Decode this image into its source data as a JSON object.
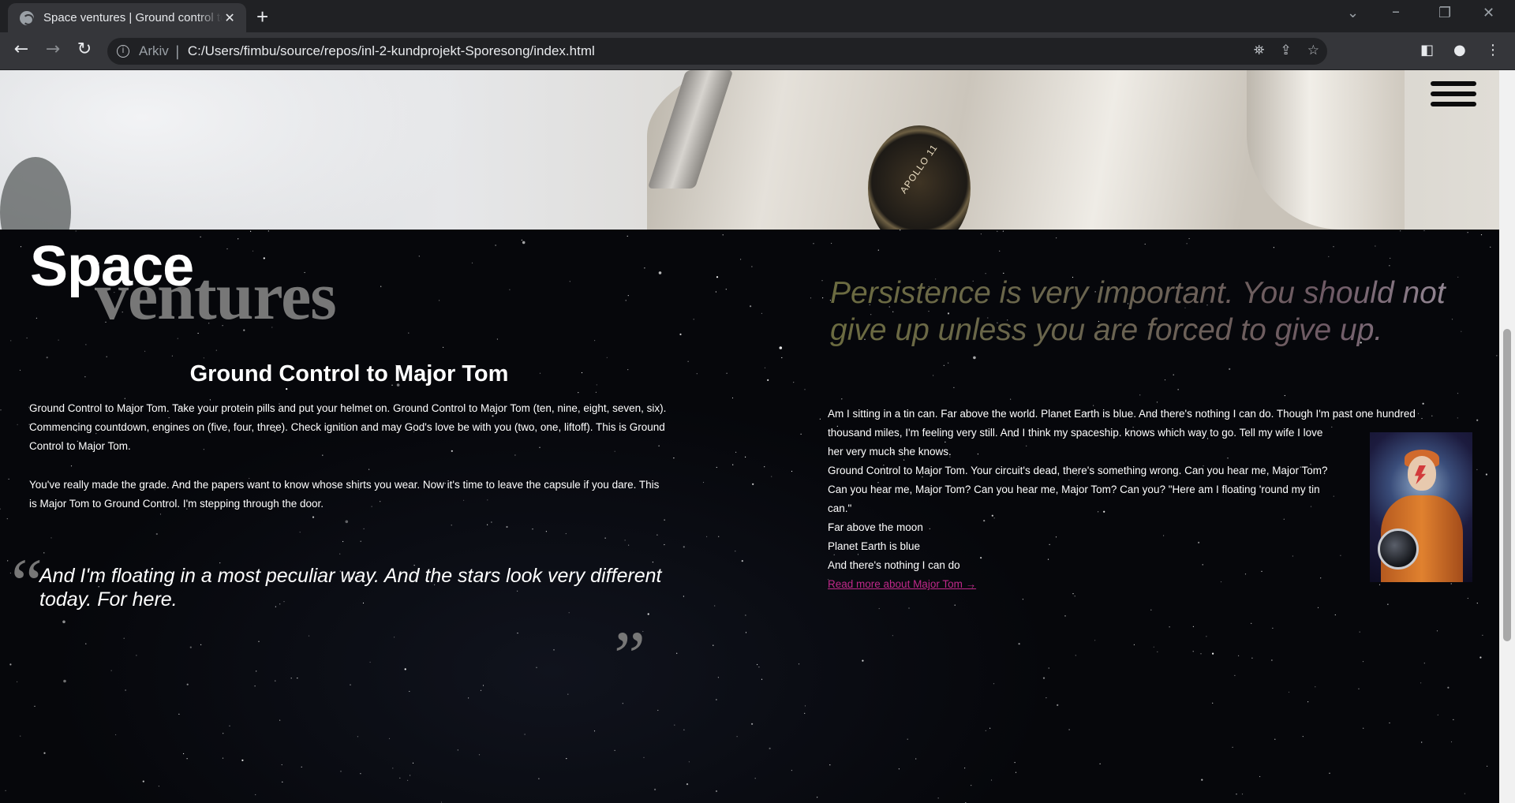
{
  "browser": {
    "tab_title": "Space ventures | Ground control to Major Tom",
    "tab_close": "✕",
    "new_tab": "+",
    "scheme_label": "Arkiv",
    "url": "C:/Users/fimbu/source/repos/inl-2-kundprojekt-Sporesong/index.html"
  },
  "hero": {
    "patch_text": "APOLLO 11"
  },
  "brand": {
    "word1": "Space",
    "word2": "ventures"
  },
  "motto": "Persistence is very important. You should not give up unless you are forced to give up.",
  "left": {
    "title": "Ground Control to Major Tom",
    "p1": "Ground Control to Major Tom. Take your protein pills and put your helmet on. Ground Control to Major Tom (ten, nine, eight, seven, six). Commencing countdown, engines on (five, four, three). Check ignition and may God's love be with you (two, one, liftoff). This is Ground Control to Major Tom.",
    "p2": "You've really made the grade. And the papers want to know whose shirts you wear. Now it's time to leave the capsule if you dare. This is Major Tom to Ground Control. I'm stepping through the door.",
    "quote_open": "“",
    "quote": "And I'm floating in a most peculiar way. And the stars look very different today. For here.",
    "quote_close": "”"
  },
  "right": {
    "line1": "Am I sitting in a tin can. Far above the world. Planet Earth is blue. And there's nothing I can do. Though I'm past one hundred",
    "line2": "thousand miles, I'm feeling very still. And I think my spaceship. knows which way to go. Tell my wife I love",
    "line3": "her very much she knows.",
    "line4": "Ground Control to Major Tom. Your circuit's dead, there's something wrong. Can you hear me, Major Tom?",
    "line5": "Can you hear me, Major Tom? Can you hear me, Major Tom? Can you? \"Here am I floating 'round my tin",
    "line6": "can.\"",
    "line7": "Far above the moon",
    "line8": "Planet Earth is blue",
    "line9": "And there's nothing I can do",
    "read_more": "Read more about Major Tom  →"
  },
  "colors": {
    "accent_link": "#c0288a",
    "brand_secondary": "#777777"
  }
}
